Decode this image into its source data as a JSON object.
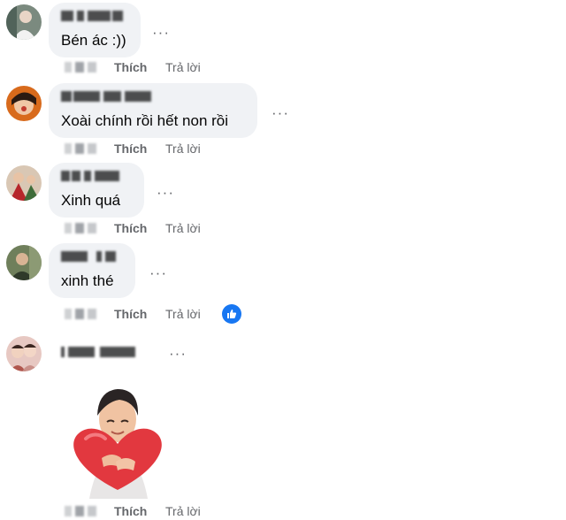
{
  "comments": [
    {
      "text": "Bén ác :))",
      "like_label": "Thích",
      "reply_label": "Trả lời",
      "more_label": "···"
    },
    {
      "text": "Xoài chính rồi hết non rồi",
      "like_label": "Thích",
      "reply_label": "Trả lời",
      "more_label": "···"
    },
    {
      "text": "Xinh quá",
      "like_label": "Thích",
      "reply_label": "Trả lời",
      "more_label": "···"
    },
    {
      "text": "xinh thé",
      "like_label": "Thích",
      "reply_label": "Trả lời",
      "more_label": "···"
    },
    {
      "text": "",
      "sticker": "heart-hug-sticker",
      "like_label": "Thích",
      "reply_label": "Trả lời",
      "more_label": "···"
    }
  ],
  "colors": {
    "bubble": "#f0f2f5",
    "accent": "#1877f2",
    "meta": "#65676b"
  }
}
